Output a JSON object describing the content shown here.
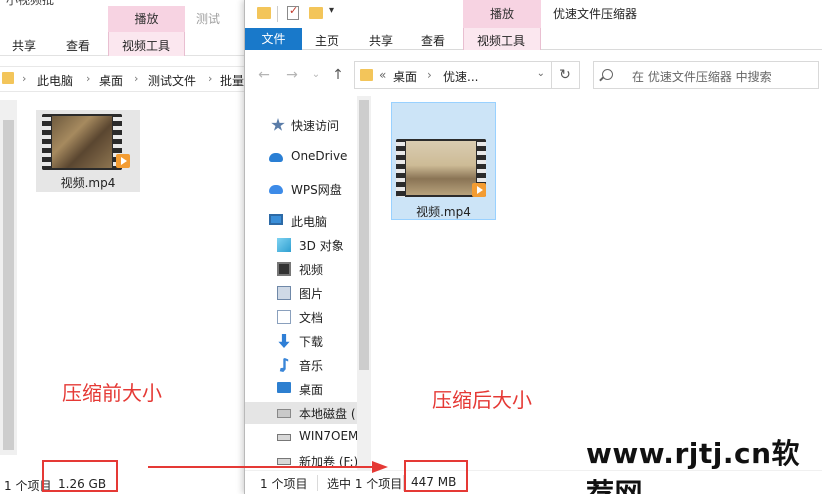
{
  "left_window": {
    "title_stub": "小视频批",
    "ribbon": {
      "context_tab": "播放",
      "test_tab": "测试",
      "tabs": [
        "共享",
        "查看",
        "视频工具"
      ]
    },
    "breadcrumb": [
      "此电脑",
      "桌面",
      "测试文件",
      "批量"
    ],
    "file": {
      "name": "视频.mp4"
    },
    "status": {
      "count": "1 个项目",
      "size": "1.26 GB"
    }
  },
  "right_window": {
    "title": "优速文件压缩器",
    "ribbon": {
      "context_tab": "播放",
      "file_tab": "文件",
      "tabs": [
        "主页",
        "共享",
        "查看",
        "视频工具"
      ]
    },
    "address": {
      "prefix": "«",
      "crumbs": [
        "桌面",
        "优速..."
      ]
    },
    "search": {
      "placeholder": "在 优速文件压缩器 中搜索"
    },
    "nav_items": [
      {
        "label": "快速访问",
        "icon": "star-icon"
      },
      {
        "label": "OneDrive",
        "icon": "cloud-icon"
      },
      {
        "label": "WPS网盘",
        "icon": "wps-cloud-icon"
      },
      {
        "label": "此电脑",
        "icon": "computer-icon"
      },
      {
        "label": "3D 对象",
        "icon": "cube-icon"
      },
      {
        "label": "视频",
        "icon": "video-folder-icon"
      },
      {
        "label": "图片",
        "icon": "pictures-folder-icon"
      },
      {
        "label": "文档",
        "icon": "documents-folder-icon"
      },
      {
        "label": "下载",
        "icon": "download-arrow-icon"
      },
      {
        "label": "音乐",
        "icon": "music-note-icon"
      },
      {
        "label": "桌面",
        "icon": "desktop-folder-icon"
      },
      {
        "label": "本地磁盘 (",
        "icon": "local-disk-icon"
      },
      {
        "label": "WIN7OEM",
        "icon": "drive-icon"
      },
      {
        "label": "新加卷 (F:)",
        "icon": "drive-icon"
      }
    ],
    "file": {
      "name": "视频.mp4"
    },
    "status": {
      "count": "1 个项目",
      "selected": "选中 1 个项目",
      "size": "447 MB"
    }
  },
  "annotations": {
    "before": "压缩前大小",
    "after": "压缩后大小"
  },
  "watermark": "www.rjtj.cn软荐网",
  "colors": {
    "annotation": "#e53935",
    "context_tab": "#f7d3e2",
    "file_tab": "#1979ca",
    "selection": "#cce4f7"
  }
}
